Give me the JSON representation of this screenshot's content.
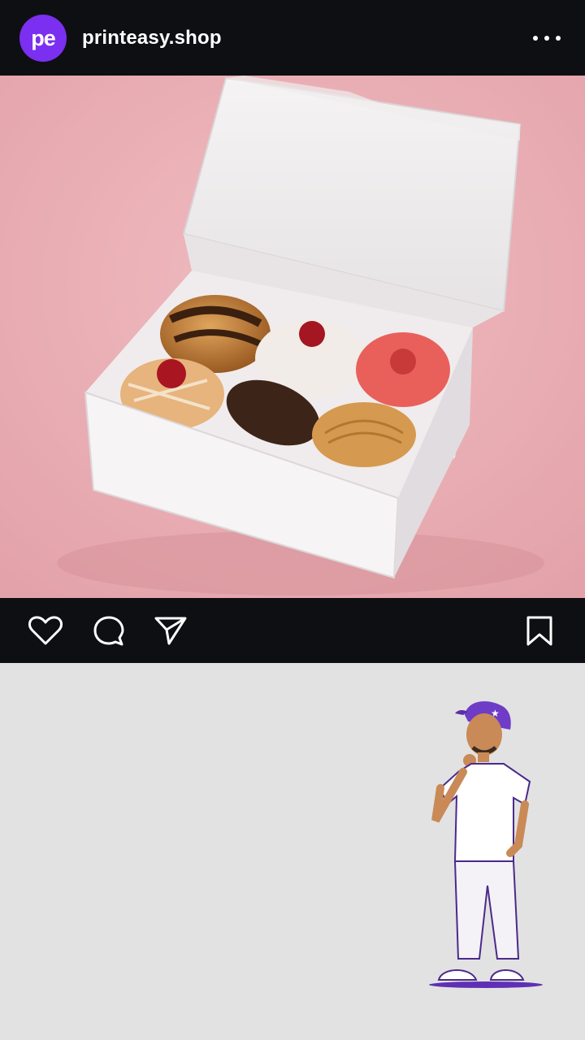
{
  "header": {
    "avatar_text": "pe",
    "account_name": "printeasy.shop",
    "menu_icon": "more-horizontal-icon"
  },
  "post": {
    "image_subject": "white pastry box with six pastries",
    "actions": {
      "like_icon": "heart-icon",
      "comment_icon": "comment-icon",
      "share_icon": "send-icon",
      "save_icon": "bookmark-icon"
    }
  },
  "colors": {
    "brand_purple": "#7b2ff0",
    "bar_dark": "#0e0f12",
    "photo_background_pink": "#eab1b6",
    "lower_background": "#e2e2e2"
  }
}
